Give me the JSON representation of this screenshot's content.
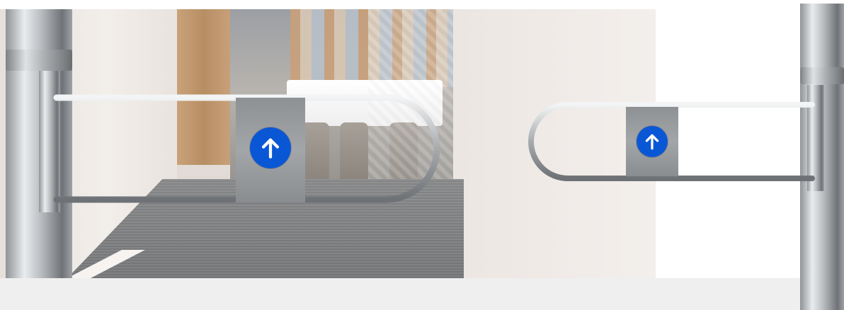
{
  "scene": {
    "description_icon": "turnstile-gates",
    "colors": {
      "arrow_badge": "#0a57d6",
      "arrow_glyph": "#ffffff",
      "steel_light": "#e9ecee",
      "steel_dark": "#6f7377",
      "floor_strip": "#efefef"
    },
    "left_gate": {
      "icon": "arrow-up-icon"
    },
    "right_gate": {
      "icon": "arrow-up-icon"
    }
  }
}
